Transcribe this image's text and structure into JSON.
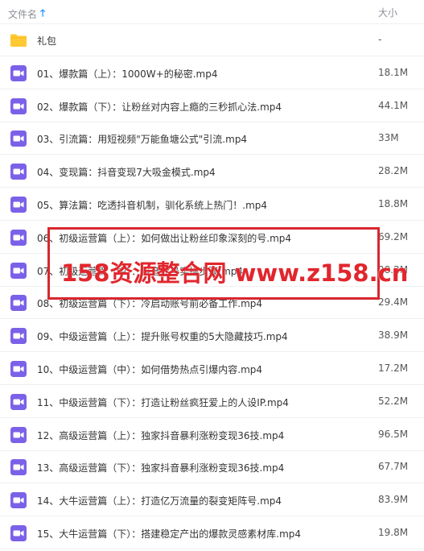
{
  "header": {
    "name_label": "文件名",
    "size_label": "大小"
  },
  "colors": {
    "video_icon": "#7b61e8",
    "folder_icon": "#ffc934",
    "watermark": "#e1262d",
    "accent": "#1a8cff"
  },
  "files": [
    {
      "icon": "folder-icon",
      "name": "礼包",
      "size": "-"
    },
    {
      "icon": "video-file-icon",
      "name": "01、爆款篇（上）：1000W+的秘密.mp4",
      "size": "18.1M"
    },
    {
      "icon": "video-file-icon",
      "name": "02、爆款篇（下）：让粉丝对内容上瘾的三秒抓心法.mp4",
      "size": "44.1M"
    },
    {
      "icon": "video-file-icon",
      "name": "03、引流篇：用短视频\"万能鱼塘公式\"引流.mp4",
      "size": "33M"
    },
    {
      "icon": "video-file-icon",
      "name": "04、变现篇：抖音变现7大吸金模式.mp4",
      "size": "28.2M"
    },
    {
      "icon": "video-file-icon",
      "name": "05、算法篇：吃透抖音机制，驯化系统上热门！.mp4",
      "size": "18.8M"
    },
    {
      "icon": "video-file-icon",
      "name": "06、初级运营篇（上）：如何做出让粉丝印象深刻的号.mp4",
      "size": "69.2M"
    },
    {
      "icon": "video-file-icon",
      "name": "07、初级运营篇（中）：抖音起号实操步骤.mp4",
      "size": "28.2M"
    },
    {
      "icon": "video-file-icon",
      "name": "08、初级运营篇（下）：冷启动账号前必备工作.mp4",
      "size": "29.4M"
    },
    {
      "icon": "video-file-icon",
      "name": "09、中级运营篇（上）：提升账号权重的5大隐藏技巧.mp4",
      "size": "38.9M"
    },
    {
      "icon": "video-file-icon",
      "name": "10、中级运营篇（中）：如何借势热点引爆内容.mp4",
      "size": "17.2M"
    },
    {
      "icon": "video-file-icon",
      "name": "11、中级运营篇（下）：打造让粉丝疯狂爱上的人设IP.mp4",
      "size": "52.2M"
    },
    {
      "icon": "video-file-icon",
      "name": "12、高级运营篇（上）：独家抖音暴利涨粉变现36技.mp4",
      "size": "96.5M"
    },
    {
      "icon": "video-file-icon",
      "name": "13、高级运营篇（下）：独家抖音暴利涨粉变现36技.mp4",
      "size": "67.7M"
    },
    {
      "icon": "video-file-icon",
      "name": "14、大牛运营篇（上）：打造亿万流量的裂变矩阵号.mp4",
      "size": "83.9M"
    },
    {
      "icon": "video-file-icon",
      "name": "15、大牛运营篇（下）：搭建稳定产出的爆款灵感素材库.mp4",
      "size": "19.8M"
    }
  ],
  "watermark": {
    "text": "158资源整合网 www.z158.cn"
  }
}
